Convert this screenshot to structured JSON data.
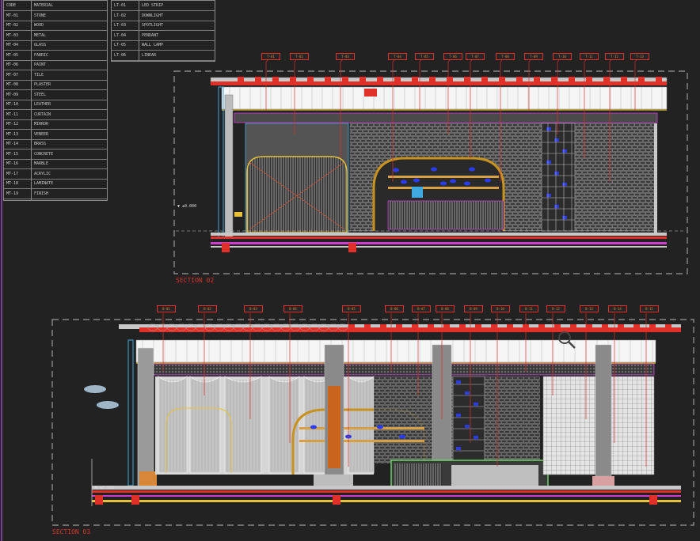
{
  "sections": [
    {
      "title": "SECTION 02"
    },
    {
      "title": "SECTION 03"
    }
  ],
  "level_marks": [
    "▼ ±0.000",
    "▼ ±0.000"
  ],
  "legend_left": [
    {
      "code": "CODE",
      "desc": "MATERIAL"
    },
    {
      "code": "MT-01",
      "desc": "STONE"
    },
    {
      "code": "MT-02",
      "desc": "WOOD"
    },
    {
      "code": "MT-03",
      "desc": "METAL"
    },
    {
      "code": "MT-04",
      "desc": "GLASS"
    },
    {
      "code": "MT-05",
      "desc": "FABRIC"
    },
    {
      "code": "MT-06",
      "desc": "PAINT"
    },
    {
      "code": "MT-07",
      "desc": "TILE"
    },
    {
      "code": "MT-08",
      "desc": "PLASTER"
    },
    {
      "code": "MT-09",
      "desc": "STEEL"
    },
    {
      "code": "MT-10",
      "desc": "LEATHER"
    },
    {
      "code": "MT-11",
      "desc": "CURTAIN"
    },
    {
      "code": "MT-12",
      "desc": "MIRROR"
    },
    {
      "code": "MT-13",
      "desc": "VENEER"
    },
    {
      "code": "MT-14",
      "desc": "BRASS"
    },
    {
      "code": "MT-15",
      "desc": "CONCRETE"
    },
    {
      "code": "MT-16",
      "desc": "MARBLE"
    },
    {
      "code": "MT-17",
      "desc": "ACRYLIC"
    },
    {
      "code": "MT-18",
      "desc": "LAMINATE"
    },
    {
      "code": "MT-19",
      "desc": "FINISH"
    }
  ],
  "legend_right": [
    {
      "code": "LT-01",
      "desc": "LED STRIP"
    },
    {
      "code": "LT-02",
      "desc": "DOWNLIGHT"
    },
    {
      "code": "LT-03",
      "desc": "SPOTLIGHT"
    },
    {
      "code": "LT-04",
      "desc": "PENDANT"
    },
    {
      "code": "LT-05",
      "desc": "WALL LAMP"
    },
    {
      "code": "LT-06",
      "desc": "LINEAR"
    }
  ],
  "tags_top": [
    "T-01",
    "T-02",
    "T-03",
    "T-04",
    "T-05",
    "T-06",
    "T-07",
    "T-08",
    "T-09",
    "T-10",
    "T-11",
    "T-12",
    "T-13"
  ],
  "tags_bottom": [
    "B-01",
    "B-02",
    "B-03",
    "B-04",
    "B-05",
    "B-06",
    "B-07",
    "B-08",
    "B-09",
    "B-10",
    "B-11",
    "B-12",
    "B-13",
    "B-14",
    "B-15",
    "B-16",
    "B-17"
  ],
  "colors": {
    "background": "#222222",
    "red": "#e0302a",
    "yellow": "#e6c23a",
    "magenta": "#d13bd1",
    "cyan": "#3fa9e0",
    "orange": "#c8641e",
    "blue": "#2b3cf0",
    "grey": "#8c8c8c",
    "frame": "#9a9a9a"
  }
}
